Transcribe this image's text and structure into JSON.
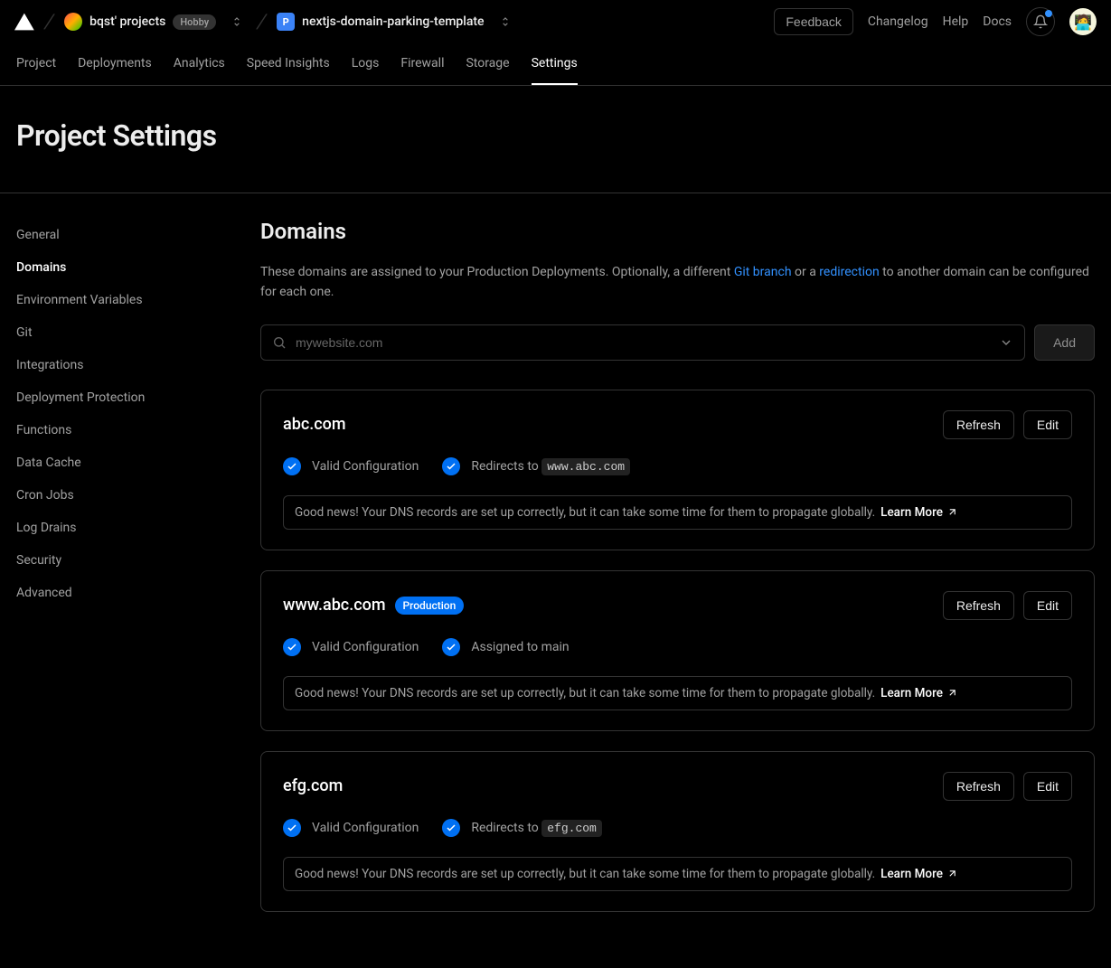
{
  "header": {
    "team_name": "bqst' projects",
    "plan_badge": "Hobby",
    "project_initial": "P",
    "project_name": "nextjs-domain-parking-template",
    "feedback": "Feedback",
    "links": {
      "changelog": "Changelog",
      "help": "Help",
      "docs": "Docs"
    }
  },
  "subnav": {
    "items": [
      {
        "label": "Project"
      },
      {
        "label": "Deployments"
      },
      {
        "label": "Analytics"
      },
      {
        "label": "Speed Insights"
      },
      {
        "label": "Logs"
      },
      {
        "label": "Firewall"
      },
      {
        "label": "Storage"
      },
      {
        "label": "Settings",
        "active": true
      }
    ]
  },
  "page_title": "Project Settings",
  "sidebar": {
    "items": [
      {
        "label": "General"
      },
      {
        "label": "Domains",
        "active": true
      },
      {
        "label": "Environment Variables"
      },
      {
        "label": "Git"
      },
      {
        "label": "Integrations"
      },
      {
        "label": "Deployment Protection"
      },
      {
        "label": "Functions"
      },
      {
        "label": "Data Cache"
      },
      {
        "label": "Cron Jobs"
      },
      {
        "label": "Log Drains"
      },
      {
        "label": "Security"
      },
      {
        "label": "Advanced"
      }
    ]
  },
  "domains": {
    "title": "Domains",
    "desc_pre": "These domains are assigned to your Production Deployments. Optionally, a different ",
    "link_git_branch": "Git branch",
    "desc_mid": " or a ",
    "link_redirection": "redirection",
    "desc_post": " to another domain can be configured for each one.",
    "input_placeholder": "mywebsite.com",
    "add_btn": "Add",
    "refresh_label": "Refresh",
    "edit_label": "Edit",
    "valid_config": "Valid Configuration",
    "redirects_to": "Redirects to ",
    "assigned_to": "Assigned to main",
    "dns_note": "Good news! Your DNS records are set up correctly, but it can take some time for them to propagate globally. ",
    "learn_more": "Learn More",
    "prod_badge": "Production",
    "cards": [
      {
        "name": "abc.com",
        "redirect_target": "www.abc.com",
        "production": false,
        "mode": "redirect"
      },
      {
        "name": "www.abc.com",
        "redirect_target": "",
        "production": true,
        "mode": "assigned"
      },
      {
        "name": "efg.com",
        "redirect_target": "efg.com",
        "production": false,
        "mode": "redirect"
      }
    ]
  }
}
